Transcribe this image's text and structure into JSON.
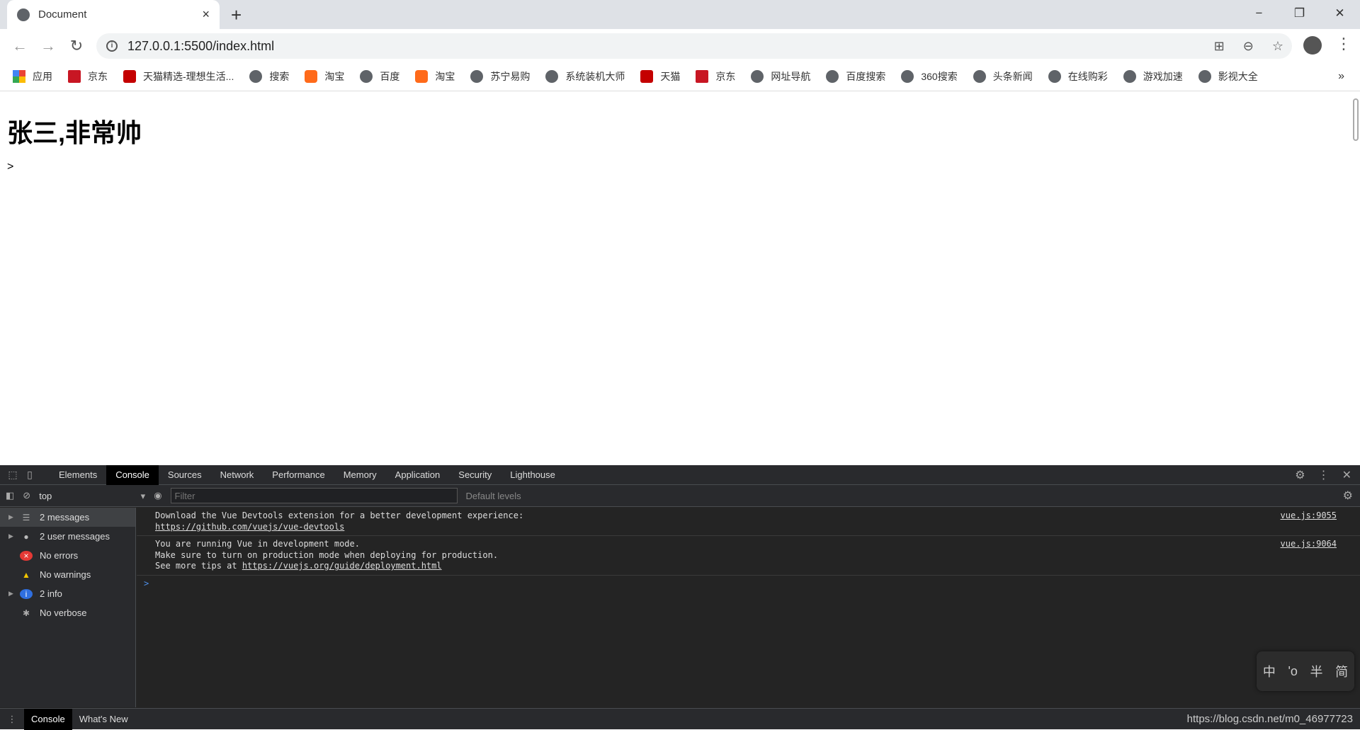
{
  "browser": {
    "tab_title": "Document",
    "tab_close": "×",
    "new_tab": "+",
    "window": {
      "minimize": "−",
      "restore": "❐",
      "close": "✕"
    },
    "nav": {
      "back": "←",
      "forward": "→",
      "reload": "↻"
    },
    "url": "127.0.0.1:5500/index.html",
    "bookmarks": [
      {
        "label": "应用",
        "icon": "apps"
      },
      {
        "label": "京东",
        "icon": "jd"
      },
      {
        "label": "天猫精选-理想生活...",
        "icon": "tm"
      },
      {
        "label": "搜索",
        "icon": "globe"
      },
      {
        "label": "淘宝",
        "icon": "tb"
      },
      {
        "label": "百度",
        "icon": "globe"
      },
      {
        "label": "淘宝",
        "icon": "tb"
      },
      {
        "label": "苏宁易购",
        "icon": "globe"
      },
      {
        "label": "系统装机大师",
        "icon": "globe"
      },
      {
        "label": "天猫",
        "icon": "tm"
      },
      {
        "label": "京东",
        "icon": "jd"
      },
      {
        "label": "网址导航",
        "icon": "globe"
      },
      {
        "label": "百度搜索",
        "icon": "globe"
      },
      {
        "label": "360搜索",
        "icon": "globe"
      },
      {
        "label": "头条新闻",
        "icon": "globe"
      },
      {
        "label": "在线购彩",
        "icon": "globe"
      },
      {
        "label": "游戏加速",
        "icon": "globe"
      },
      {
        "label": "影视大全",
        "icon": "globe"
      }
    ],
    "bookmarks_more": "»"
  },
  "page": {
    "heading": "张三,非常帅",
    "text": ">"
  },
  "devtools": {
    "tabs": [
      "Elements",
      "Console",
      "Sources",
      "Network",
      "Performance",
      "Memory",
      "Application",
      "Security",
      "Lighthouse"
    ],
    "active_tab": "Console",
    "context": "top",
    "filter_placeholder": "Filter",
    "levels": "Default levels",
    "sidebar": [
      {
        "label": "2 messages",
        "icon": "list",
        "expand": true
      },
      {
        "label": "2 user messages",
        "icon": "user",
        "expand": true
      },
      {
        "label": "No errors",
        "icon": "error",
        "expand": false
      },
      {
        "label": "No warnings",
        "icon": "warning",
        "expand": false
      },
      {
        "label": "2 info",
        "icon": "info",
        "expand": true
      },
      {
        "label": "No verbose",
        "icon": "verbose",
        "expand": false
      }
    ],
    "messages": [
      {
        "lines": [
          "Download the Vue Devtools extension for a better development experience:"
        ],
        "link": "https://github.com/vuejs/vue-devtools",
        "link_prefix": "",
        "source": "vue.js:9055"
      },
      {
        "lines": [
          "You are running Vue in development mode.",
          "Make sure to turn on production mode when deploying for production."
        ],
        "link_prefix": "See more tips at ",
        "link": "https://vuejs.org/guide/deployment.html",
        "source": "vue.js:9064"
      }
    ],
    "prompt": ">",
    "drawer_tabs": [
      "Console",
      "What's New"
    ],
    "ime": [
      "中",
      "'o",
      "半",
      "简"
    ]
  },
  "watermark": "https://blog.csdn.net/m0_46977723"
}
